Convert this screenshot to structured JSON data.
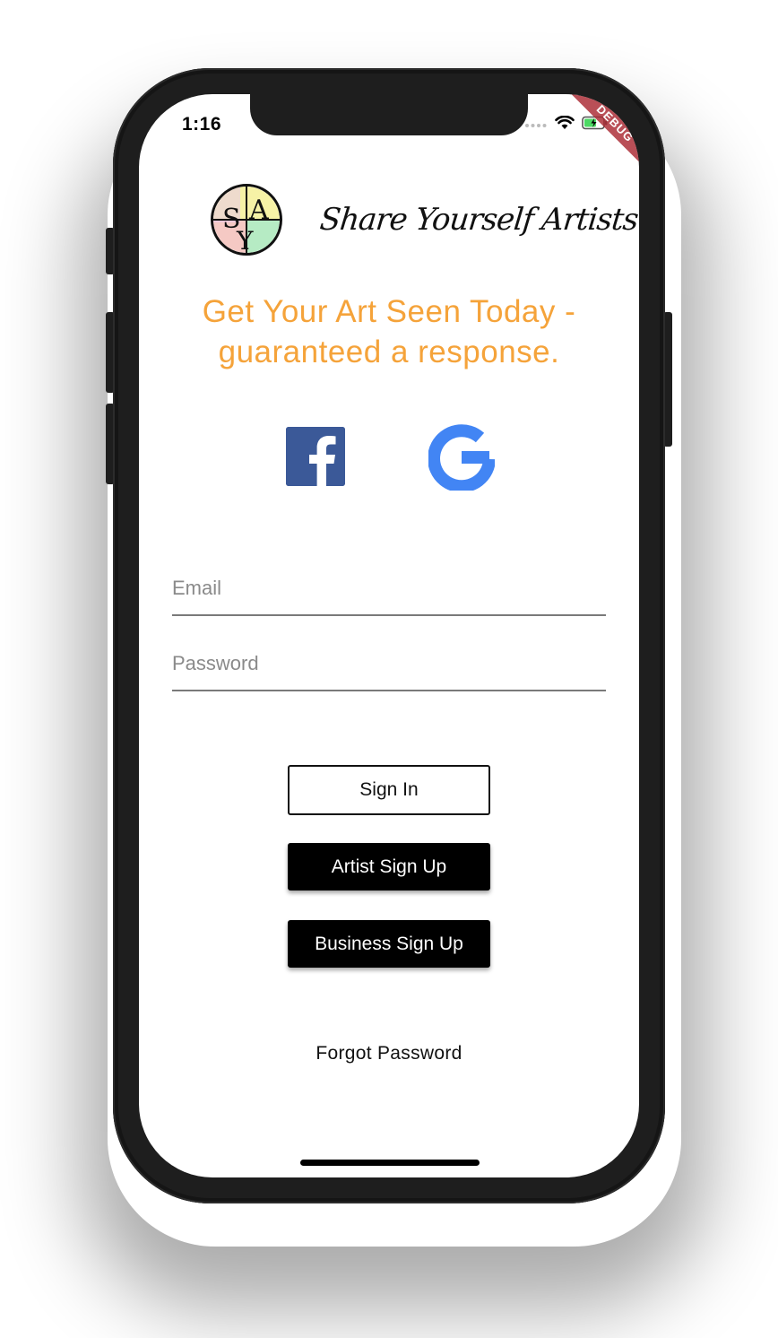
{
  "status_bar": {
    "time": "1:16",
    "icons": [
      "signal-dots-icon",
      "wifi-icon",
      "battery-charging-icon"
    ]
  },
  "debug_banner": "DEBUG",
  "brand": {
    "logo_icon": "sya-logo-icon",
    "logo_letters": "SYA",
    "name": "Share Yourself Artists"
  },
  "tagline": {
    "line1": "Get Your Art Seen Today -",
    "line2": "guaranteed a response.",
    "color": "#f5a33a"
  },
  "social_login": {
    "facebook_icon": "facebook-icon",
    "google_icon": "google-icon",
    "facebook_color": "#3b5998",
    "google_color": "#4285f4"
  },
  "form": {
    "email_placeholder": "Email",
    "email_value": "",
    "password_placeholder": "Password",
    "password_value": ""
  },
  "buttons": {
    "sign_in": "Sign In",
    "artist_sign_up": "Artist Sign Up",
    "business_sign_up": "Business Sign Up"
  },
  "forgot_password": "Forgot Password"
}
